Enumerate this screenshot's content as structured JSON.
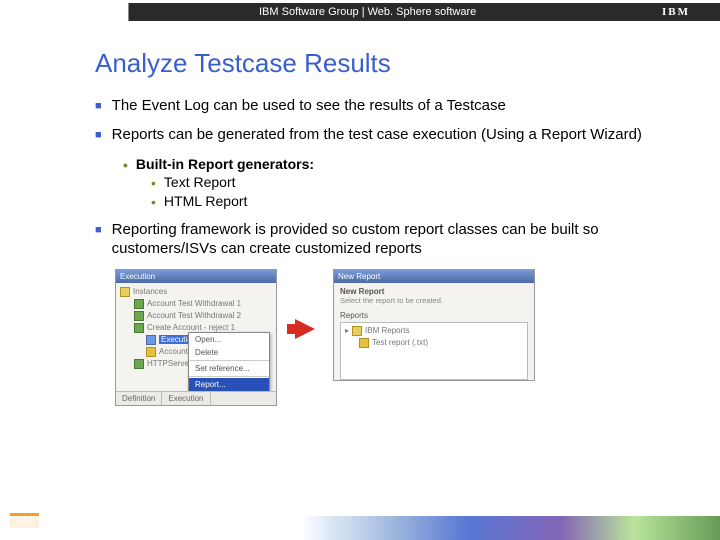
{
  "topbar": {
    "left": "IBM Software Group  |  Web. Sphere software",
    "logo": "IBM"
  },
  "title": "Analyze Testcase Results",
  "bullets": {
    "b1": "The Event Log can be used to see the results of a Testcase",
    "b2": "Reports can be generated from the test case execution (Using a Report Wizard)",
    "b2a": "Built-in Report generators:",
    "b2a1": "Text Report",
    "b2a2": "HTML Report",
    "b3": "Reporting framework is provided so custom report classes can be built so customers/ISVs can create customized reports"
  },
  "leftpanel": {
    "header": "Execution",
    "rows": {
      "r0": "Instances",
      "r1": "Account Test Withdrawal 1",
      "r2": "Account Test Withdrawal 2",
      "r3": "Create Account - reject 1",
      "r4": "Execution",
      "r5": "Account",
      "r6": "HTTPServer"
    },
    "tabs": {
      "t1": "Definition",
      "t2": "Execution"
    },
    "menu": {
      "m1": "Open...",
      "m2": "Delete",
      "m3": "Set reference...",
      "m4": "Report..."
    }
  },
  "rightpanel": {
    "header": "New Report",
    "sub1": "New Report",
    "sub2": "Select the report to be created.",
    "box_label": "Reports",
    "tree": {
      "n1": "IBM Reports",
      "n2": "Test report (.txt)"
    }
  },
  "page": "174"
}
